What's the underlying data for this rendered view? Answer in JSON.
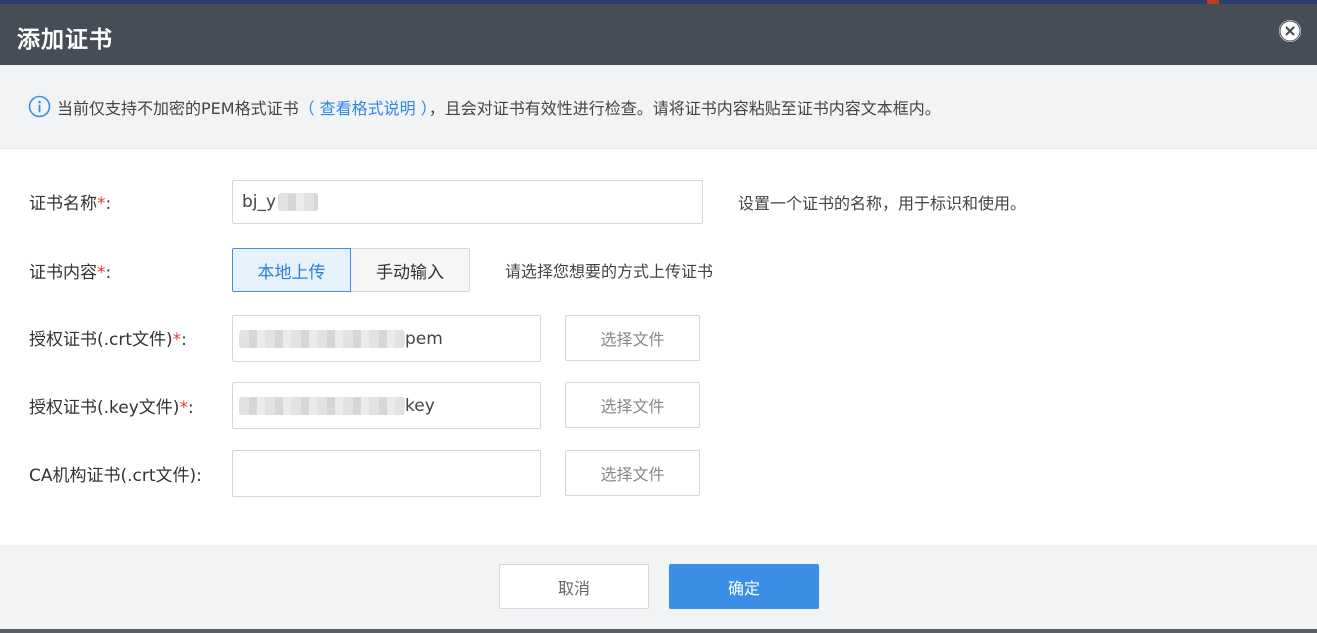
{
  "dialog": {
    "title": "添加证书"
  },
  "notice": {
    "text_before": "当前仅支持不加密的PEM格式证书",
    "link": "（ 查看格式说明 ）",
    "text_after": "，且会对证书有效性进行检查。请将证书内容粘贴至证书内容文本框内。"
  },
  "form": {
    "cert_name": {
      "label": "证书名称",
      "required_mark": "*",
      "colon": ":",
      "value": "bj_y",
      "hint": "设置一个证书的名称，用于标识和使用。"
    },
    "cert_content": {
      "label": "证书内容",
      "required_mark": "*",
      "colon": ":",
      "option_local": "本地上传",
      "option_manual": "手动输入",
      "selected": "本地上传",
      "hint": "请选择您想要的方式上传证书"
    },
    "crt_file": {
      "label": "授权证书(.crt文件)",
      "required_mark": "*",
      "colon": ":",
      "value_suffix": "pem",
      "button": "选择文件"
    },
    "key_file": {
      "label": "授权证书(.key文件)",
      "required_mark": "*",
      "colon": ":",
      "value_suffix": "key",
      "button": "选择文件"
    },
    "ca_file": {
      "label": "CA机构证书(.crt文件):",
      "value": "",
      "button": "选择文件"
    }
  },
  "footer": {
    "cancel_label": "取消",
    "ok_label": "确定"
  },
  "colors": {
    "header_bg": "#474d57",
    "accent": "#3a8ee6",
    "required": "#e03b3b"
  },
  "icons": [
    "close-icon",
    "info-icon"
  ]
}
